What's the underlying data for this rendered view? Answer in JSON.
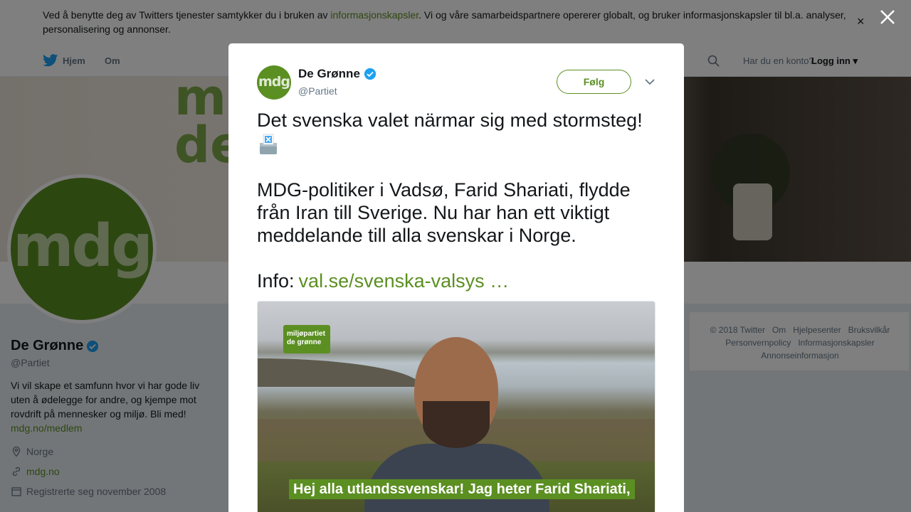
{
  "cookie_banner": {
    "text_before": "Ved å benytte deg av Twitters tjenester samtykker du i bruken av ",
    "link_text": "informasjonskapsler",
    "text_after": ". Vi og våre samarbeidspartnere opererer globalt, og bruker informasjonskapsler til bl.a. analyser, personalisering og annonser.",
    "close_label": "×"
  },
  "nav": {
    "home": "Hjem",
    "about": "Om",
    "account_question": "Har du en konto?",
    "login": "Logg inn"
  },
  "header": {
    "brush_text_1": "mi",
    "brush_text_2": "de"
  },
  "profile": {
    "avatar_text": "mdg",
    "name": "De Grønne",
    "handle": "@Partiet",
    "bio": "Vi vil skape et samfunn hvor vi har gode liv uten å ødelegge for andre, og kjempe mot rovdrift på mennesker og miljø. Bli med!",
    "bio_link": "mdg.no/medlem",
    "location": "Norge",
    "website": "mdg.no",
    "joined": "Registrerte seg november 2008"
  },
  "footer": {
    "links_line1": [
      "© 2018 Twitter",
      "Om",
      "Hjelpesenter",
      "Bruksvilkår"
    ],
    "links_line2": [
      "Personvernpolicy",
      "Informasjonskapsler"
    ],
    "links_line3": [
      "Annonseinformasjon"
    ]
  },
  "tweet": {
    "avatar_text": "mdg",
    "author_name": "De Grønne",
    "author_handle": "@Partiet",
    "follow_label": "Følg",
    "paragraph1": "Det svenska valet närmar sig med stormsteg!",
    "paragraph2": "MDG-politiker i Vadsø, Farid Shariati, flydde från Iran till Sverige. Nu har han ett viktigt meddelande till alla svenskar i Norge.",
    "info_label": "Info:",
    "info_link": "val.se/svenska-valsys …",
    "media": {
      "logo_text": "miljøpartiet de grønne",
      "caption": "Hej alla utlandssvenskar! Jag heter Farid Shariati,"
    }
  },
  "colors": {
    "accent": "#5b8f22",
    "verified": "#1da1f2"
  },
  "icons": {
    "twitter": "twitter-bird-icon",
    "search": "search-icon",
    "location": "location-pin-icon",
    "link": "link-icon",
    "calendar": "calendar-icon",
    "close": "close-icon",
    "verified": "verified-badge-icon",
    "caret": "chevron-down-icon",
    "ballot": "ballot-box-icon"
  }
}
